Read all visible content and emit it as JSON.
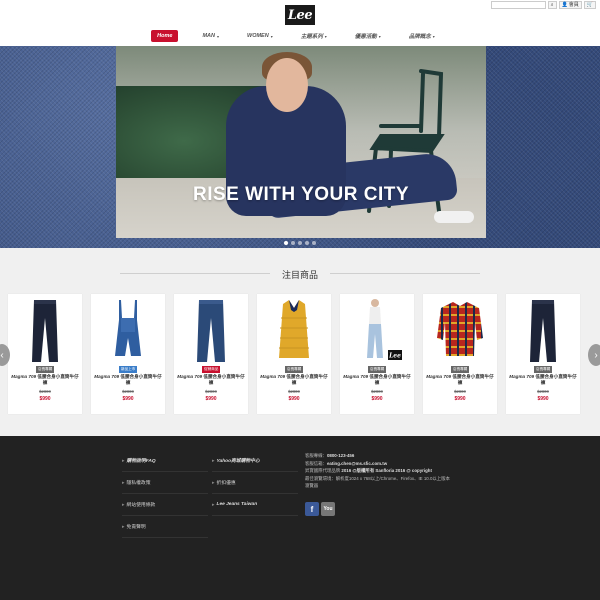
{
  "topbar": {
    "search_placeholder": "",
    "buttons": [
      "搜尋",
      "會員",
      "購物車"
    ]
  },
  "logo": {
    "text": "Lee"
  },
  "nav": {
    "items": [
      {
        "label": "Home",
        "active": true
      },
      {
        "label": "MAN",
        "caret": "▾"
      },
      {
        "label": "WOMEN",
        "caret": "▾"
      },
      {
        "label": "主題系列",
        "caret": "▾"
      },
      {
        "label": "優惠活動",
        "caret": "▾"
      },
      {
        "label": "品牌概念",
        "caret": "▾"
      }
    ]
  },
  "banner": {
    "headline": "RISE WITH YOUR CITY",
    "dot_count": 5,
    "active_dot": 1
  },
  "featured": {
    "title": "注目商品",
    "products": [
      {
        "badge": "店長專屬",
        "badge_color": "gray",
        "brand": "Magma 709",
        "name": "低腰合身小直筒牛仔褲",
        "old_price": "$2800",
        "new_price": "$990",
        "type": "jeans-dark"
      },
      {
        "badge": "新品上市",
        "badge_color": "blue",
        "brand": "Magma 709",
        "name": "低腰合身小直筒牛仔褲",
        "old_price": "$2800",
        "new_price": "$990",
        "type": "overalls"
      },
      {
        "badge": "促銷商品",
        "badge_color": "red",
        "brand": "Magma 709",
        "name": "低腰合身小直筒牛仔褲",
        "old_price": "$2800",
        "new_price": "$990",
        "type": "jeans-mid"
      },
      {
        "badge": "店長專屬",
        "badge_color": "gray",
        "brand": "Magma 709",
        "name": "低腰合身小直筒牛仔褲",
        "old_price": "$2800",
        "new_price": "$990",
        "type": "vest"
      },
      {
        "badge": "店長專屬",
        "badge_color": "gray",
        "brand": "Magma 709",
        "name": "低腰合身小直筒牛仔褲",
        "old_price": "$2800",
        "new_price": "$990",
        "type": "model-jeans",
        "logo": "Lee"
      },
      {
        "badge": "店長專屬",
        "badge_color": "gray",
        "brand": "Magma 709",
        "name": "低腰合身小直筒牛仔褲",
        "old_price": "$2800",
        "new_price": "$990",
        "type": "plaid-shirt"
      },
      {
        "badge": "店長專屬",
        "badge_color": "gray",
        "brand": "Magma 709",
        "name": "低腰合身小直筒牛仔褲",
        "old_price": "$2800",
        "new_price": "$990",
        "type": "jeans-dark"
      }
    ]
  },
  "footer": {
    "col1": [
      "購物說明FAQ",
      "隱私權政策",
      "網站使用條款",
      "免責聲明"
    ],
    "col2": [
      "Yahoo商城購物中心",
      "折扣優惠",
      "Lee Jeans Taiwan"
    ],
    "contact": {
      "phone_label": "客服專線：",
      "phone": "0800-123-456",
      "email_label": "客服信箱：",
      "email": "eating.chen@ms.sfic.com.tw",
      "copyright_prefix": "昇寶國際代理品牌",
      "copyright": "2016 @版權所有 Sanfloria 2016 @ copyright",
      "browser_label": "最佳瀏覽環境：",
      "browser": "解析度1024 x 768以上/Chrome、Firefox、IE 10.0以上版本",
      "browser_tail": "瀏覽器"
    },
    "social": {
      "facebook": "f",
      "youtube": "You"
    }
  }
}
